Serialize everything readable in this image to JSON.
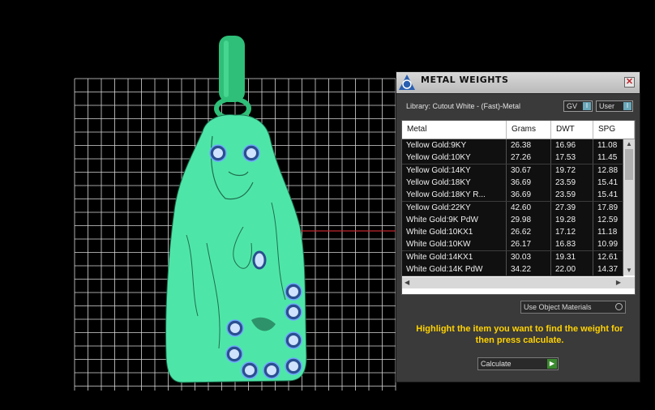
{
  "panel": {
    "title": "METAL WEIGHTS",
    "close_glyph": "✕",
    "library_label": "Library: Cutout White - (Fast)-Metal",
    "toggles": [
      {
        "label": "GV",
        "knob": "I"
      },
      {
        "label": "User",
        "knob": "I"
      }
    ],
    "table": {
      "headers": [
        "Metal",
        "Grams",
        "DWT",
        "SPG"
      ],
      "rows": [
        [
          "Yellow Gold:9KY",
          "26.38",
          "16.96",
          "11.08"
        ],
        [
          "Yellow Gold:10KY",
          "27.26",
          "17.53",
          "11.45"
        ],
        [
          "Yellow Gold:14KY",
          "30.67",
          "19.72",
          "12.88"
        ],
        [
          "Yellow Gold:18KY",
          "36.69",
          "23.59",
          "15.41"
        ],
        [
          "Yellow Gold:18KY R...",
          "36.69",
          "23.59",
          "15.41"
        ],
        [
          "Yellow Gold:22KY",
          "42.60",
          "27.39",
          "17.89"
        ],
        [
          "White Gold:9K PdW",
          "29.98",
          "19.28",
          "12.59"
        ],
        [
          "White Gold:10KX1",
          "26.62",
          "17.12",
          "11.18"
        ],
        [
          "White Gold:10KW",
          "26.17",
          "16.83",
          "10.99"
        ],
        [
          "White Gold:14KX1",
          "30.03",
          "19.31",
          "12.61"
        ],
        [
          "White Gold:14K PdW",
          "34.22",
          "22.00",
          "14.37"
        ]
      ]
    },
    "use_object_materials": "Use Object Materials",
    "instruction": "Highlight the item you want to find the weight for then press calculate.",
    "calculate_label": "Calculate",
    "calculate_glyph": "▶"
  },
  "colors": {
    "pendant": "#4ee6a8",
    "bail": "#2fbf78",
    "grid": "#d9d9d9",
    "instruction_text": "#ffd200",
    "axis_line": "#c0262c"
  },
  "icons": [
    "app-logo-icon",
    "close-icon",
    "toggle-knob-icon",
    "radio-icon",
    "play-arrow-icon",
    "scroll-up-icon",
    "scroll-down-icon",
    "scroll-left-icon",
    "scroll-right-icon"
  ]
}
